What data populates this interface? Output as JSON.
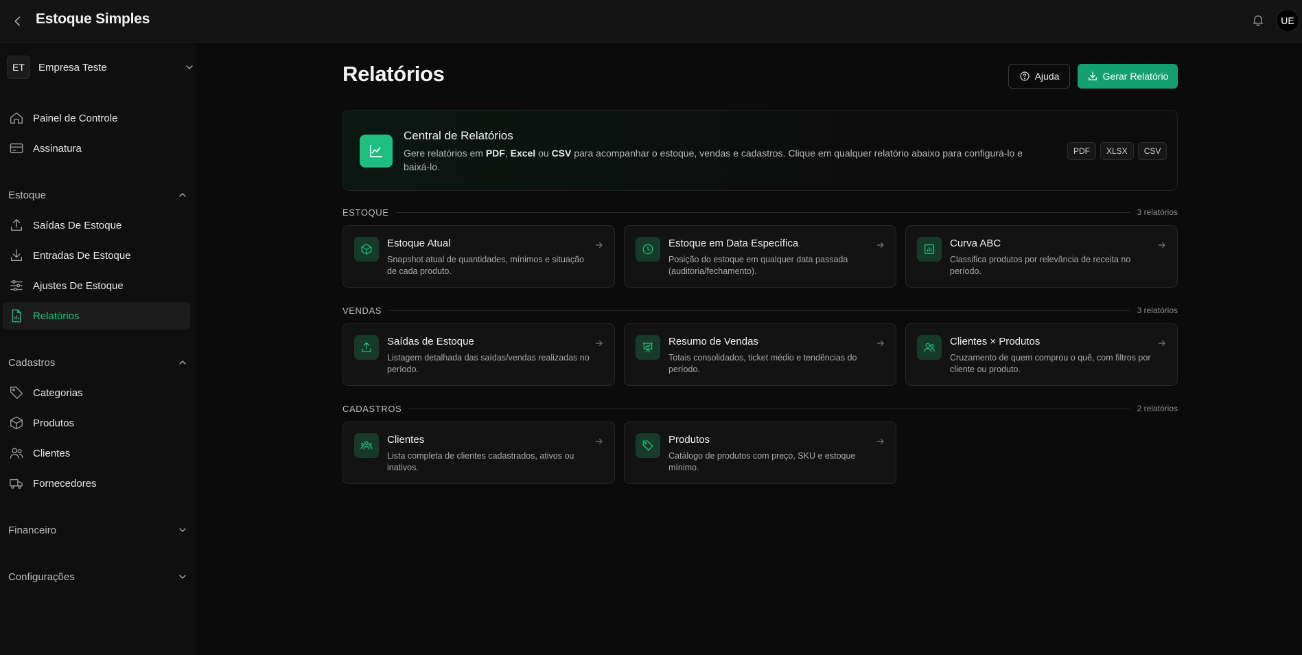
{
  "app": {
    "title": "Estoque Simples",
    "user_initials": "UE"
  },
  "company": {
    "initials": "ET",
    "name": "Empresa Teste"
  },
  "sidebar": {
    "top_items": [
      {
        "label": "Painel de Controle",
        "icon": "home-icon"
      },
      {
        "label": "Assinatura",
        "icon": "card-icon"
      }
    ],
    "sections": [
      {
        "label": "Estoque",
        "expanded": true
      },
      {
        "label": "Cadastros",
        "expanded": true
      },
      {
        "label": "Financeiro",
        "expanded": false
      },
      {
        "label": "Configurações",
        "expanded": false
      }
    ],
    "estoque_items": [
      {
        "label": "Saídas De Estoque",
        "icon": "upload-icon"
      },
      {
        "label": "Entradas De Estoque",
        "icon": "download-icon"
      },
      {
        "label": "Ajustes De Estoque",
        "icon": "sliders-icon"
      },
      {
        "label": "Relatórios",
        "icon": "report-icon",
        "active": true
      }
    ],
    "cadastros_items": [
      {
        "label": "Categorias",
        "icon": "tag-icon"
      },
      {
        "label": "Produtos",
        "icon": "box-icon"
      },
      {
        "label": "Clientes",
        "icon": "users-icon"
      },
      {
        "label": "Fornecedores",
        "icon": "truck-icon"
      }
    ]
  },
  "main": {
    "title": "Relatórios",
    "help_button": "Ajuda",
    "generate_button": "Gerar Relatório",
    "hero": {
      "title": "Central de Relatórios",
      "desc_1": "Gere relatórios em ",
      "fmt_pdf": "PDF",
      "sep_1": ", ",
      "fmt_excel": "Excel",
      "sep_2": " ou ",
      "fmt_csv": "CSV",
      "desc_2": " para acompanhar o estoque, vendas e cadastros. Clique em qualquer relatório abaixo para configurá-lo e baixá-lo.",
      "tags": [
        "PDF",
        "XLSX",
        "CSV"
      ]
    },
    "groups": [
      {
        "name": "ESTOQUE",
        "count": "3 relatórios",
        "cards": [
          {
            "title": "Estoque Atual",
            "desc": "Snapshot atual de quantidades, mínimos e situação de cada produto.",
            "icon": "box-icon"
          },
          {
            "title": "Estoque em Data Específica",
            "desc": "Posição do estoque em qualquer data passada (auditoria/fechamento).",
            "icon": "clock-icon"
          },
          {
            "title": "Curva ABC",
            "desc": "Classifica produtos por relevância de receita no período.",
            "icon": "bar-chart-icon"
          }
        ]
      },
      {
        "name": "VENDAS",
        "count": "3 relatórios",
        "cards": [
          {
            "title": "Saídas de Estoque",
            "desc": "Listagem detalhada das saídas/vendas realizadas no período.",
            "icon": "upload-icon"
          },
          {
            "title": "Resumo de Vendas",
            "desc": "Totais consolidados, ticket médio e tendências do período.",
            "icon": "presentation-icon"
          },
          {
            "title": "Clientes × Produtos",
            "desc": "Cruzamento de quem comprou o quê, com filtros por cliente ou produto.",
            "icon": "users-icon"
          }
        ]
      },
      {
        "name": "CADASTROS",
        "count": "2 relatórios",
        "cards": [
          {
            "title": "Clientes",
            "desc": "Lista completa de clientes cadastrados, ativos ou inativos.",
            "icon": "team-icon"
          },
          {
            "title": "Produtos",
            "desc": "Catálogo de produtos com preço, SKU e estoque mínimo.",
            "icon": "tag-icon"
          }
        ]
      }
    ]
  },
  "colors": {
    "accent": "#14a070",
    "accent_text": "#22c07f",
    "background": "#0b0b0b",
    "card": "#131313"
  }
}
